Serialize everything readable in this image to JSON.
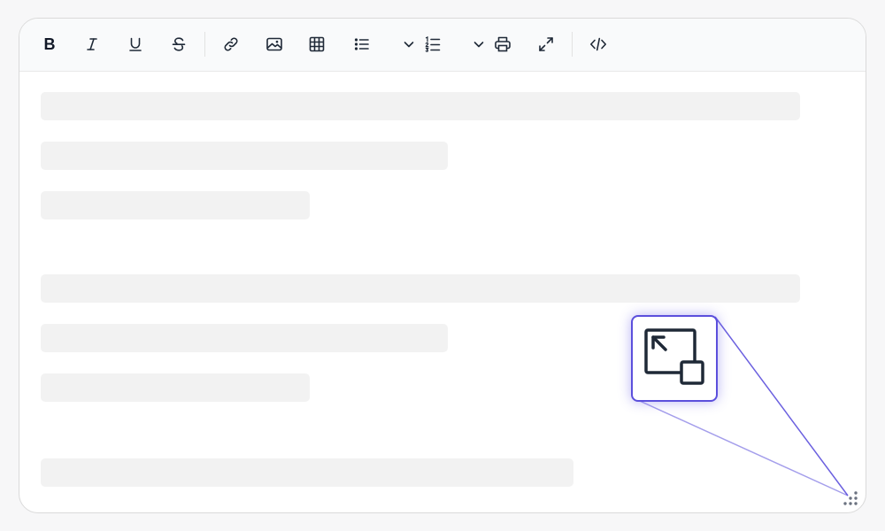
{
  "toolbar": {
    "bold_label": "B",
    "buttons": [
      {
        "name": "bold-button",
        "icon": "bold-icon"
      },
      {
        "name": "italic-button",
        "icon": "italic-icon"
      },
      {
        "name": "underline-button",
        "icon": "underline-icon"
      },
      {
        "name": "strikethrough-button",
        "icon": "strikethrough-icon"
      },
      {
        "name": "link-button",
        "icon": "link-icon"
      },
      {
        "name": "image-button",
        "icon": "image-icon"
      },
      {
        "name": "table-button",
        "icon": "table-icon"
      },
      {
        "name": "bullet-list-button",
        "icon": "bullet-list-icon"
      },
      {
        "name": "bullet-list-dropdown",
        "icon": "chevron-down-icon"
      },
      {
        "name": "numbered-list-button",
        "icon": "numbered-list-icon"
      },
      {
        "name": "numbered-list-dropdown",
        "icon": "chevron-down-icon"
      },
      {
        "name": "print-button",
        "icon": "print-icon"
      },
      {
        "name": "fullscreen-button",
        "icon": "expand-icon"
      },
      {
        "name": "source-code-button",
        "icon": "code-icon"
      }
    ]
  },
  "zoom_callout": {
    "icon": "resize-corner-icon",
    "accent_color": "#5b4fdc"
  },
  "resize_handle": {
    "icon": "resize-grip-icon"
  },
  "colors": {
    "toolbar_bg": "#f9fafb",
    "skeleton": "#f2f2f2",
    "icon": "#1f2937",
    "accent": "#5b4fdc"
  }
}
